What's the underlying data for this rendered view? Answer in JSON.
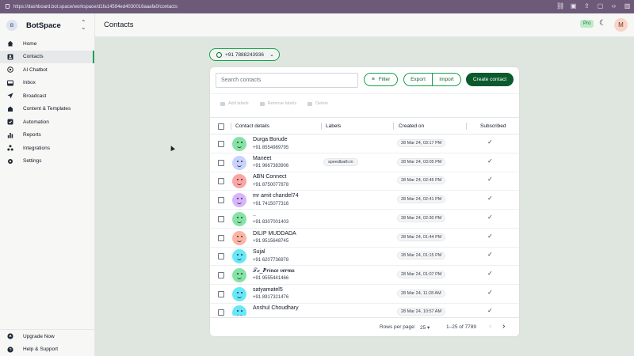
{
  "browser": {
    "url": "https://dashboard.bot.space/workspace/d1fa14594ed4030016aaafa0/contacts"
  },
  "brand": {
    "initial": "B",
    "name": "BotSpace"
  },
  "sidebar": {
    "items": [
      {
        "label": "Home",
        "icon": "home-icon"
      },
      {
        "label": "Contacts",
        "icon": "contacts-icon"
      },
      {
        "label": "AI Chatbot",
        "icon": "chatbot-icon"
      },
      {
        "label": "Inbox",
        "icon": "inbox-icon"
      },
      {
        "label": "Broadcast",
        "icon": "send-icon"
      },
      {
        "label": "Content & Templates",
        "icon": "templates-icon"
      },
      {
        "label": "Automation",
        "icon": "automation-icon"
      },
      {
        "label": "Reports",
        "icon": "reports-icon"
      },
      {
        "label": "Integrations",
        "icon": "integrations-icon"
      },
      {
        "label": "Settings",
        "icon": "settings-icon"
      }
    ],
    "bottom": [
      {
        "label": "Upgrade Now",
        "icon": "upgrade-icon"
      },
      {
        "label": "Help & Support",
        "icon": "help-icon"
      }
    ]
  },
  "header": {
    "title": "Contacts",
    "plan_badge": "Pro",
    "user_initial": "M"
  },
  "phone_selector": {
    "number": "+91 7888243936"
  },
  "toolbar": {
    "search_placeholder": "Search contacts",
    "filter_label": "Filter",
    "export_label": "Export",
    "import_label": "Import",
    "create_label": "Create contact"
  },
  "bulk_actions": {
    "add_labels": "Add labels",
    "remove_labels": "Remove labels",
    "delete": "Delete"
  },
  "table": {
    "headers": {
      "contact": "Contact details",
      "labels": "Labels",
      "created": "Created on",
      "subscribed": "Subscribed"
    },
    "rows": [
      {
        "name": "Durga Borude",
        "phone": "+91 8554989795",
        "label": "",
        "created": "28 Mar 24, 03:17 PM",
        "subscribed": "✓",
        "color": "#86e3a6"
      },
      {
        "name": "Maneet",
        "phone": "+91 9667383906",
        "label": "speedbath.in",
        "created": "28 Mar 24, 03:05 PM",
        "subscribed": "✓",
        "color": "#c7d2fe"
      },
      {
        "name": "ABN Connect",
        "phone": "+91 8750077878",
        "label": "",
        "created": "28 Mar 24, 02:45 PM",
        "subscribed": "✓",
        "color": "#fca5a5"
      },
      {
        "name": "mr amit chandel74",
        "phone": "+91 7415077316",
        "label": "",
        "created": "28 Mar 24, 02:41 PM",
        "subscribed": "✓",
        "color": "#d8b4fe"
      },
      {
        "name": "..",
        "phone": "+91 8307001403",
        "label": "",
        "created": "28 Mar 24, 02:30 PM",
        "subscribed": "✓",
        "color": "#86e3a6"
      },
      {
        "name": "DILIP MUDDADA",
        "phone": "+91 9515648745",
        "label": "",
        "created": "28 Mar 24, 01:44 PM",
        "subscribed": "✓",
        "color": "#fbb4a5"
      },
      {
        "name": "Sujal",
        "phone": "+91 6207736978",
        "label": "",
        "created": "28 Mar 24, 01:15 PM",
        "subscribed": "✓",
        "color": "#67e8f9"
      },
      {
        "name": "𝒯𝓍_𝑷𝒓𝒊𝒏𝒄𝒆 𝒗𝒆𝒓𝒎𝒂",
        "phone": "+91 9555441466",
        "label": "",
        "created": "28 Mar 24, 01:07 PM",
        "subscribed": "✓",
        "color": "#86e3a6"
      },
      {
        "name": "satyamatel5",
        "phone": "+91 8917321476",
        "label": "",
        "created": "28 Mar 24, 11:28 AM",
        "subscribed": "✓",
        "color": "#67e8f9"
      },
      {
        "name": "Anshul Choudhary",
        "phone": "",
        "label": "",
        "created": "28 Mar 24, 10:57 AM",
        "subscribed": "✓",
        "color": "#67e8f9"
      }
    ]
  },
  "pagination": {
    "rows_per_page_label": "Rows per page:",
    "rows_per_page": "25",
    "range": "1–25 of 7789"
  }
}
